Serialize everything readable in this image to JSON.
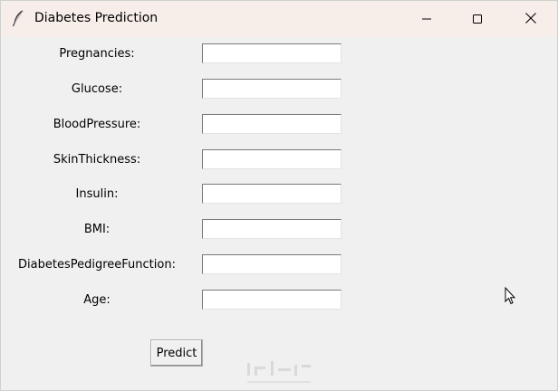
{
  "window": {
    "title": "Diabetes Prediction",
    "icon": "feather-icon",
    "controls": [
      "minimize-icon",
      "maximize-icon",
      "close-icon"
    ]
  },
  "form": {
    "fields": [
      {
        "label": "Pregnancies:",
        "value": ""
      },
      {
        "label": "Glucose:",
        "value": ""
      },
      {
        "label": "BloodPressure:",
        "value": ""
      },
      {
        "label": "SkinThickness:",
        "value": ""
      },
      {
        "label": "Insulin:",
        "value": ""
      },
      {
        "label": "BMI:",
        "value": ""
      },
      {
        "label": "DiabetesPedigreeFunction:",
        "value": ""
      },
      {
        "label": "Age:",
        "value": ""
      }
    ],
    "predict_label": "Predict"
  },
  "colors": {
    "titlebar": "#f7eeea",
    "window_bg": "#f0f0f0",
    "entry_bg": "#ffffff"
  }
}
